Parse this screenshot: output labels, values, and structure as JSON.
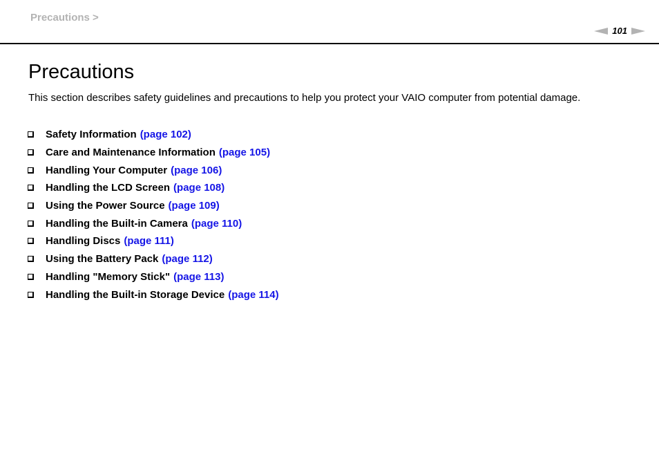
{
  "header": {
    "breadcrumb": "Precautions >",
    "page_number": "101",
    "prev_icon": "left-arrow-icon",
    "next_icon": "right-arrow-icon"
  },
  "main": {
    "title": "Precautions",
    "intro": "This section describes safety guidelines and precautions to help you protect your VAIO computer from potential damage.",
    "items": [
      {
        "label": "Safety Information",
        "link": "(page 102)"
      },
      {
        "label": "Care and Maintenance Information",
        "link": "(page 105)"
      },
      {
        "label": "Handling Your Computer",
        "link": "(page 106)"
      },
      {
        "label": "Handling the LCD Screen",
        "link": "(page 108)"
      },
      {
        "label": "Using the Power Source",
        "link": "(page 109)"
      },
      {
        "label": "Handling the Built-in Camera",
        "link": "(page 110)"
      },
      {
        "label": "Handling Discs",
        "link": "(page 111)"
      },
      {
        "label": "Using the Battery Pack",
        "link": "(page 112)"
      },
      {
        "label": "Handling \"Memory Stick\"",
        "link": "(page 113)"
      },
      {
        "label": "Handling the Built-in Storage Device",
        "link": "(page 114)"
      }
    ]
  },
  "colors": {
    "link": "#1515e6",
    "breadcrumb": "#b3b3b3"
  }
}
